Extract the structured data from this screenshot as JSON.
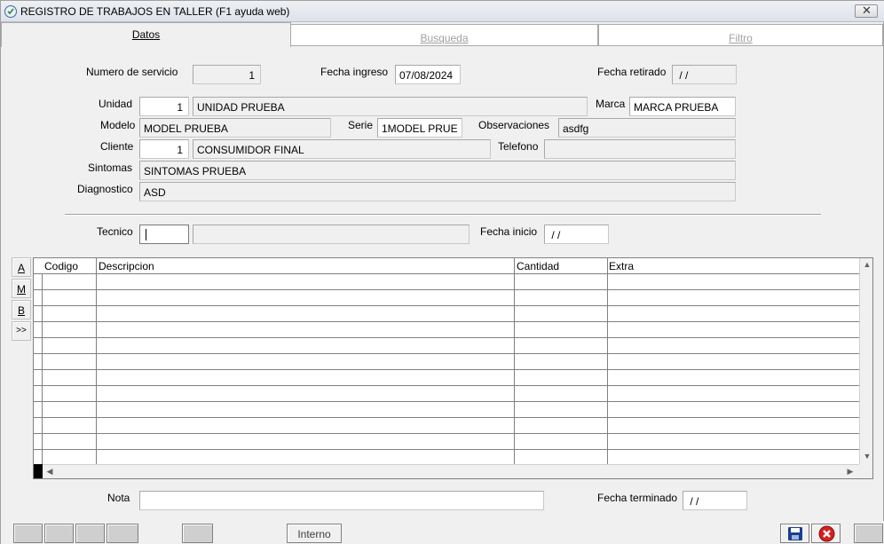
{
  "window": {
    "title": "REGISTRO DE TRABAJOS EN TALLER (F1 ayuda web)"
  },
  "tabs": [
    {
      "label": "Datos",
      "active": true
    },
    {
      "label": "Busqueda",
      "active": false
    },
    {
      "label": "Filtro",
      "active": false
    }
  ],
  "form": {
    "numero_servicio": {
      "label": "Numero de servicio",
      "value": "1"
    },
    "fecha_ingreso": {
      "label": "Fecha ingreso",
      "value": "07/08/2024"
    },
    "fecha_retirado": {
      "label": "Fecha retirado",
      "value": " / /"
    },
    "unidad": {
      "label": "Unidad",
      "code": "1",
      "name": "UNIDAD PRUEBA"
    },
    "marca": {
      "label": "Marca",
      "value": "MARCA PRUEBA"
    },
    "modelo": {
      "label": "Modelo",
      "value": "MODEL PRUEBA"
    },
    "serie": {
      "label": "Serie",
      "value": "1MODEL PRUE"
    },
    "observaciones": {
      "label": "Observaciones",
      "value": "asdfg"
    },
    "cliente": {
      "label": "Cliente",
      "code": "1",
      "name": "CONSUMIDOR FINAL"
    },
    "telefono": {
      "label": "Telefono",
      "value": ""
    },
    "sintomas": {
      "label": "Sintomas",
      "value": "SINTOMAS PRUEBA"
    },
    "diagnostico": {
      "label": "Diagnostico",
      "value": "ASD"
    },
    "tecnico": {
      "label": "Tecnico",
      "code": "",
      "name": ""
    },
    "fecha_inicio": {
      "label": "Fecha inicio",
      "value": " / /"
    },
    "nota": {
      "label": "Nota",
      "value": ""
    },
    "fecha_terminado": {
      "label": "Fecha terminado",
      "value": " / /"
    }
  },
  "side_buttons": [
    "A",
    "M",
    "B",
    ">>"
  ],
  "grid": {
    "columns": [
      "Codigo",
      "Descripcion",
      "Cantidad",
      "Extra"
    ],
    "rows": []
  },
  "bottom": {
    "interno_label": "Interno"
  },
  "colors": {
    "close_red": "#d42020",
    "save_blue": "#1a3f8f"
  }
}
